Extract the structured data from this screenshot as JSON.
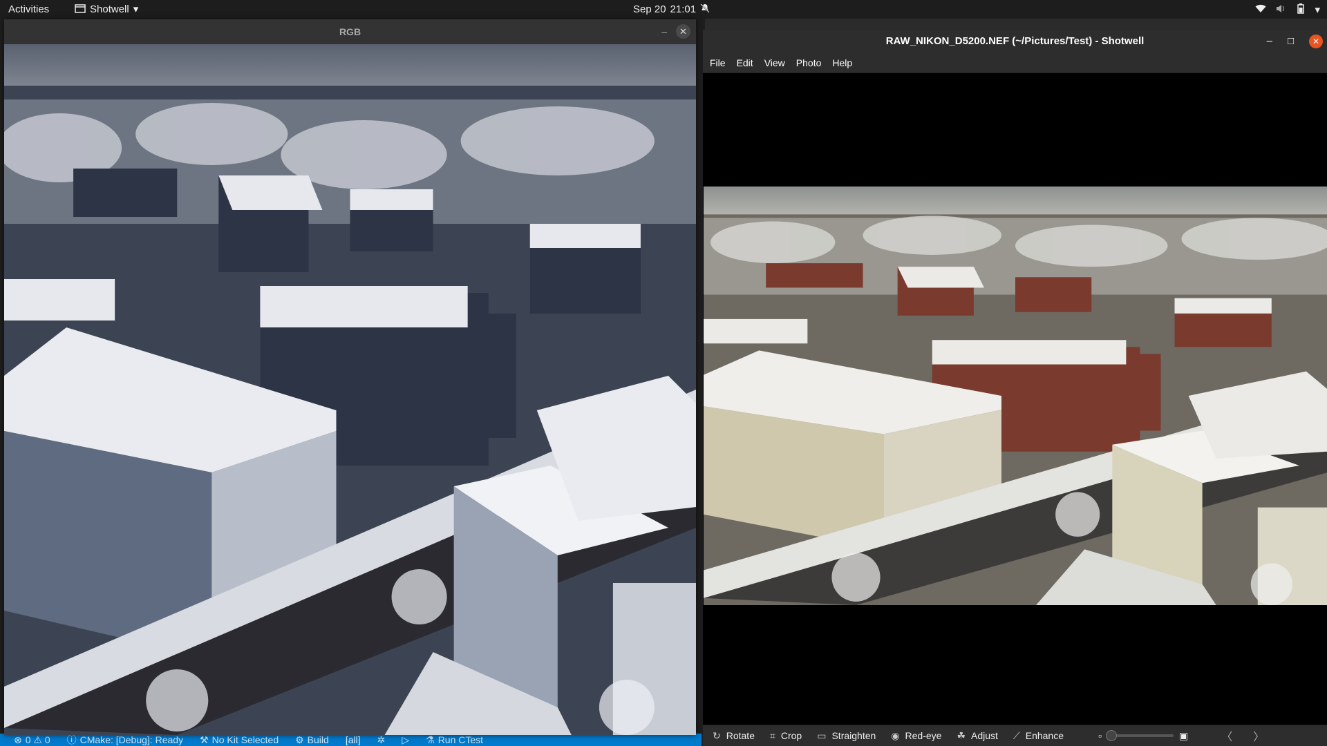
{
  "topbar": {
    "activities": "Activities",
    "app_name": "Shotwell",
    "date": "Sep 20",
    "time": "21:01",
    "icons": [
      "notification-muted-icon",
      "wifi-icon",
      "volume-icon",
      "battery-icon",
      "power-menu-icon"
    ]
  },
  "vscode_statusbar": {
    "problems": "0 ⚠ 0",
    "cmake": "CMake: [Debug]: Ready",
    "kit": "No Kit Selected",
    "build": "Build",
    "target": "[all]",
    "run_ctest": "Run CTest"
  },
  "rgb_window": {
    "title": "RGB",
    "minimize": "–",
    "close": "✕"
  },
  "shotwell": {
    "title": "RAW_NIKON_D5200.NEF (~/Pictures/Test) - Shotwell",
    "minimize": "–",
    "maximize": "□",
    "close": "✕",
    "menu": [
      "File",
      "Edit",
      "View",
      "Photo",
      "Help"
    ],
    "toolbar": {
      "rotate": "Rotate",
      "crop": "Crop",
      "straighten": "Straighten",
      "redeye": "Red-eye",
      "adjust": "Adjust",
      "enhance": "Enhance",
      "zoom_level": 0.0,
      "prev": "〈",
      "next": "〉"
    }
  },
  "colors": {
    "topbar_bg": "#1d1d1d",
    "statusbar_bg": "#007acc",
    "close_accent": "#e95420",
    "rgb_photo_tint": "#3a4458",
    "shotwell_photo_tint": "#8a7f6a"
  }
}
